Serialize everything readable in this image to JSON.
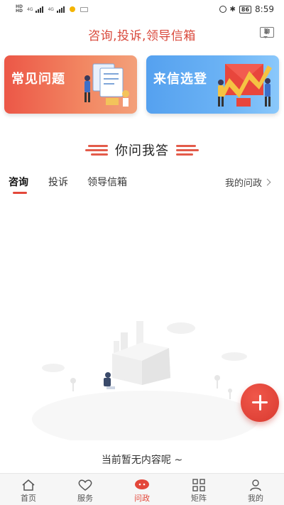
{
  "status_bar": {
    "left_hd1": "HD",
    "left_hd2": "HD",
    "net1": "4G",
    "net2": "4G",
    "battery": "86",
    "time": "8:59"
  },
  "header": {
    "title": "咨询,投诉,领导信箱",
    "message_icon_text": "聊"
  },
  "cards": [
    {
      "label": "常见问题",
      "color": "#ec5747"
    },
    {
      "label": "来信选登",
      "color": "#55a1ef"
    }
  ],
  "section": {
    "title": "你问我答"
  },
  "tabs": [
    {
      "label": "咨询",
      "active": true
    },
    {
      "label": "投诉",
      "active": false
    },
    {
      "label": "领导信箱",
      "active": false
    }
  ],
  "my_link": "我的问政",
  "empty_text": "当前暂无内容呢 ~",
  "bottom_nav": [
    {
      "label": "首页",
      "icon": "home-icon"
    },
    {
      "label": "服务",
      "icon": "heart-icon"
    },
    {
      "label": "问政",
      "icon": "chat-bubble-icon",
      "active": true
    },
    {
      "label": "矩阵",
      "icon": "grid-icon"
    },
    {
      "label": "我的",
      "icon": "user-icon"
    }
  ],
  "accent_color": "#e3473a"
}
